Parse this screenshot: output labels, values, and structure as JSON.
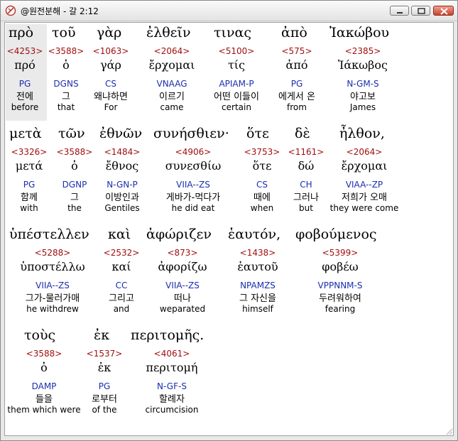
{
  "window": {
    "title": "@원전분해 - 갈 2:12",
    "buttons": {
      "minimize": "minimize-icon",
      "maximize": "maximize-icon",
      "close": "close-icon"
    }
  },
  "colors": {
    "strong": "#a01010",
    "parse": "#1a2eb0",
    "text": "#000000",
    "background": "#ffffff"
  },
  "greek_words": [
    "πρὸ",
    "τοῦ",
    "γὰρ",
    "ἐλθεῖν",
    "τινας",
    "ἀπὸ",
    "Ἰακώβου",
    "μετὰ",
    "τῶν",
    "ἐθνῶν",
    "συνήσθιεν·",
    "ὅτε",
    "δὲ",
    "ἦλθον,",
    "ὑπέστελλεν",
    "καὶ",
    "ἀφώριζεν",
    "ἑαυτόν,",
    "φοβούμενος",
    "τοὺς",
    "ἐκ",
    "περιτομῆς."
  ],
  "cells": [
    {
      "strong": "<4253>",
      "lemma": "πρό",
      "parse": "PG",
      "korean": "전에",
      "english": "before"
    },
    {
      "strong": "<3588>",
      "lemma": "ὁ",
      "parse": "DGNS",
      "korean": "그",
      "english": "that"
    },
    {
      "strong": "<1063>",
      "lemma": "γάρ",
      "parse": "CS",
      "korean": "왜냐하면",
      "english": "For"
    },
    {
      "strong": "<2064>",
      "lemma": "ἔρχομαι",
      "parse": "VNAAG",
      "korean": "이르기",
      "english": "came"
    },
    {
      "strong": "<5100>",
      "lemma": "τίς",
      "parse": "APIAM-P",
      "korean": "어떤 이들이",
      "english": "certain"
    },
    {
      "strong": "<575>",
      "lemma": "ἀπό",
      "parse": "PG",
      "korean": "에게서 온",
      "english": "from"
    },
    {
      "strong": "<2385>",
      "lemma": "Ἰάκωβος",
      "parse": "N-GM-S",
      "korean": "야고보",
      "english": "James"
    },
    {
      "strong": "<3326>",
      "lemma": "μετά",
      "parse": "PG",
      "korean": "함께",
      "english": "with"
    },
    {
      "strong": "<3588>",
      "lemma": "ὁ",
      "parse": "DGNP",
      "korean": "그",
      "english": "the"
    },
    {
      "strong": "<1484>",
      "lemma": "ἔθνος",
      "parse": "N-GN-P",
      "korean": "이방인과",
      "english": "Gentiles"
    },
    {
      "strong": "<4906>",
      "lemma": "συνεσθίω",
      "parse": "VIIA--ZS",
      "korean": "게바가-먹다가",
      "english": "he did eat"
    },
    {
      "strong": "<3753>",
      "lemma": "ὅτε",
      "parse": "CS",
      "korean": "때에",
      "english": "when"
    },
    {
      "strong": "<1161>",
      "lemma": "δώ",
      "parse": "CH",
      "korean": "그러나",
      "english": "but"
    },
    {
      "strong": "<2064>",
      "lemma": "ἔρχομαι",
      "parse": "VIAA--ZP",
      "korean": "저희가 오매",
      "english": "they were come"
    },
    {
      "strong": "<5288>",
      "lemma": "ὑποστέλλω",
      "parse": "VIIA--ZS",
      "korean": "그가-물러가매",
      "english": "he withdrew"
    },
    {
      "strong": "<2532>",
      "lemma": "καί",
      "parse": "CC",
      "korean": "그리고",
      "english": "and"
    },
    {
      "strong": "<873>",
      "lemma": "ἀφορίζω",
      "parse": "VIIA--ZS",
      "korean": "떠나",
      "english": "weparated"
    },
    {
      "strong": "<1438>",
      "lemma": "ἑαυτοῦ",
      "parse": "NPAMZS",
      "korean": "그 자신을",
      "english": "himself"
    },
    {
      "strong": "<5399>",
      "lemma": "φοβέω",
      "parse": "VPPNNM-S",
      "korean": "두려워하여",
      "english": "fearing"
    },
    {
      "strong": "<3588>",
      "lemma": "ὁ",
      "parse": "DAMP",
      "korean": "들을",
      "english": "them which were"
    },
    {
      "strong": "<1537>",
      "lemma": "ἐκ",
      "parse": "PG",
      "korean": "로부터",
      "english": "of the"
    },
    {
      "strong": "<4061>",
      "lemma": "περιτομή",
      "parse": "N-GF-S",
      "korean": "할례자",
      "english": "circumcision"
    }
  ]
}
